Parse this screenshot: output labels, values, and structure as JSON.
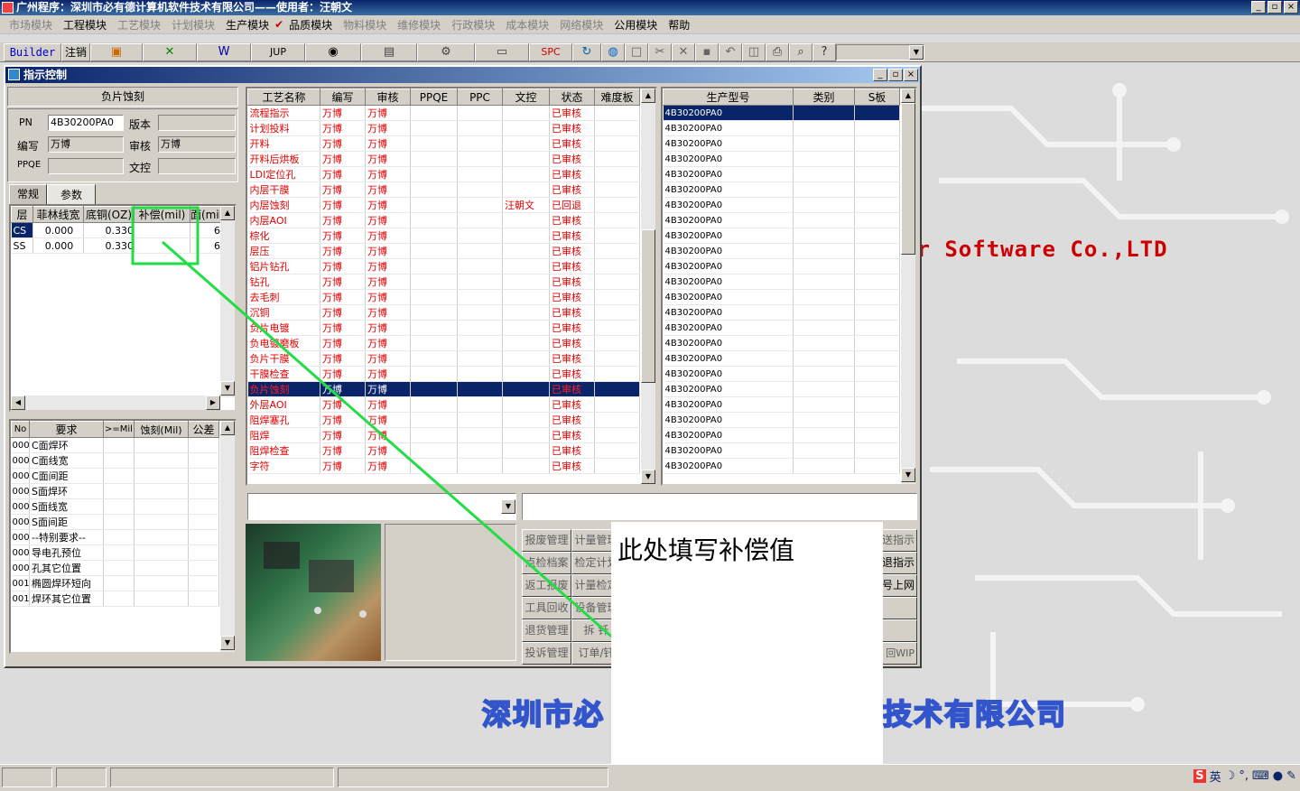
{
  "app": {
    "title": "广州程序：深圳市必有德计算机软件技术有限公司——使用者：汪朝文",
    "window_controls": [
      "_",
      "▫",
      "×"
    ]
  },
  "menu": [
    {
      "label": "市场模块",
      "enabled": false
    },
    {
      "label": "工程模块",
      "enabled": true
    },
    {
      "label": "工艺模块",
      "enabled": false
    },
    {
      "label": "计划模块",
      "enabled": false
    },
    {
      "label": "生产模块",
      "enabled": true
    },
    {
      "label": "品质模块",
      "enabled": true,
      "checked": true
    },
    {
      "label": "物料模块",
      "enabled": false
    },
    {
      "label": "维修模块",
      "enabled": false
    },
    {
      "label": "行政模块",
      "enabled": false
    },
    {
      "label": "成本模块",
      "enabled": false
    },
    {
      "label": "网络模块",
      "enabled": false
    },
    {
      "label": "公用模块",
      "enabled": true
    },
    {
      "label": "帮助",
      "enabled": true
    }
  ],
  "toolbar": {
    "builder": "Builder",
    "logout": "注销",
    "icons": [
      "ppt-icon",
      "excel-icon",
      "word-icon",
      "jup-icon",
      "eye-icon",
      "database-icon",
      "gears-icon",
      "monitor-icon",
      "spc-icon",
      "refresh-icon",
      "globe-icon",
      "new-icon",
      "cut-icon",
      "delete-icon",
      "save-icon",
      "undo-icon",
      "preview-icon",
      "print-icon",
      "find-icon",
      "help-icon"
    ],
    "jup": "JUP",
    "spc": "SPC",
    "combo_value": ""
  },
  "background": {
    "slogan": "er Software Co.,LTD",
    "company": "深圳市必",
    "company_tail": "技术有限公司"
  },
  "child": {
    "title": "指示控制",
    "process_name": "负片蚀刻",
    "fields": {
      "pn_label": "PN",
      "pn": "4B30200PA0",
      "version_label": "版本",
      "version": "",
      "author_label": "编写",
      "author": "万博",
      "reviewer_label": "审核",
      "reviewer": "万博",
      "ppqe_label": "PPQE",
      "ppqe": "",
      "doc_label": "文控",
      "doc": ""
    },
    "tabs": [
      "常规",
      "参数"
    ],
    "layer_table": {
      "headers": [
        "层",
        "菲林线宽",
        "底铜(OZ)",
        "补偿(mil)",
        "面(mil"
      ],
      "rows": [
        [
          "CS",
          "0.000",
          "0.330",
          "",
          "6"
        ],
        [
          "SS",
          "0.000",
          "0.330",
          "",
          "6"
        ]
      ]
    },
    "req_table": {
      "headers": [
        "No",
        "要求",
        ">=Mil",
        "蚀刻(Mil)",
        "公差"
      ],
      "rows": [
        [
          "000",
          "C面焊环"
        ],
        [
          "000",
          "C面线宽"
        ],
        [
          "000",
          "C面间距"
        ],
        [
          "000",
          "S面焊环"
        ],
        [
          "000",
          "S面线宽"
        ],
        [
          "000",
          "S面间距"
        ],
        [
          "000",
          "--特别要求--"
        ],
        [
          "000",
          "导电孔预位"
        ],
        [
          "000",
          "孔其它位置"
        ],
        [
          "001",
          "椭圆焊环短向"
        ],
        [
          "001",
          "焊环其它位置"
        ]
      ]
    },
    "process_table": {
      "headers": [
        "工艺名称",
        "编写",
        "审核",
        "PPQE",
        "PPC",
        "文控",
        "状态",
        "难度板"
      ],
      "selected_index": 18,
      "rows": [
        [
          "流程指示",
          "万博",
          "万博",
          "",
          "",
          "",
          "已审核"
        ],
        [
          "计划投料",
          "万博",
          "万博",
          "",
          "",
          "",
          "已审核"
        ],
        [
          "开料",
          "万博",
          "万博",
          "",
          "",
          "",
          "已审核"
        ],
        [
          "开料后烘板",
          "万博",
          "万博",
          "",
          "",
          "",
          "已审核"
        ],
        [
          "LDI定位孔",
          "万博",
          "万博",
          "",
          "",
          "",
          "已审核"
        ],
        [
          "内层干膜",
          "万博",
          "万博",
          "",
          "",
          "",
          "已审核"
        ],
        [
          "内层蚀刻",
          "万博",
          "万博",
          "",
          "",
          "汪朝文",
          "已回退"
        ],
        [
          "内层AOI",
          "万博",
          "万博",
          "",
          "",
          "",
          "已审核"
        ],
        [
          "棕化",
          "万博",
          "万博",
          "",
          "",
          "",
          "已审核"
        ],
        [
          "层压",
          "万博",
          "万博",
          "",
          "",
          "",
          "已审核"
        ],
        [
          "铝片钻孔",
          "万博",
          "万博",
          "",
          "",
          "",
          "已审核"
        ],
        [
          "钻孔",
          "万博",
          "万博",
          "",
          "",
          "",
          "已审核"
        ],
        [
          "去毛刺",
          "万博",
          "万博",
          "",
          "",
          "",
          "已审核"
        ],
        [
          "沉铜",
          "万博",
          "万博",
          "",
          "",
          "",
          "已审核"
        ],
        [
          "负片电镀",
          "万博",
          "万博",
          "",
          "",
          "",
          "已审核"
        ],
        [
          "负电镀磨板",
          "万博",
          "万博",
          "",
          "",
          "",
          "已审核"
        ],
        [
          "负片干膜",
          "万博",
          "万博",
          "",
          "",
          "",
          "已审核"
        ],
        [
          "干膜检查",
          "万博",
          "万博",
          "",
          "",
          "",
          "已审核"
        ],
        [
          "负片蚀刻",
          "万博",
          "万博",
          "",
          "",
          "",
          "已审核"
        ],
        [
          "外层AOI",
          "万博",
          "万博",
          "",
          "",
          "",
          "已审核"
        ],
        [
          "阻焊塞孔",
          "万博",
          "万博",
          "",
          "",
          "",
          "已审核"
        ],
        [
          "阻焊",
          "万博",
          "万博",
          "",
          "",
          "",
          "已审核"
        ],
        [
          "阻焊检查",
          "万博",
          "万博",
          "",
          "",
          "",
          "已审核"
        ],
        [
          "字符",
          "万博",
          "万博",
          "",
          "",
          "",
          "已审核"
        ]
      ]
    },
    "model_table": {
      "headers": [
        "生产型号",
        "类别",
        "S板"
      ],
      "model": "4B30200PA0",
      "row_count": 24
    },
    "combo_left": "",
    "text_right": "",
    "buttons_left": [
      [
        "报废管理",
        "计量管理"
      ],
      [
        "点检档案",
        "检定计划"
      ],
      [
        "返工报废",
        "计量检定"
      ],
      [
        "工具回收",
        "设备管理"
      ],
      [
        "退货管理",
        "拆 钎"
      ],
      [
        "投诉管理",
        "订单/钎"
      ]
    ],
    "buttons_right": [
      "送指示",
      "退指示",
      "号上网",
      "",
      "",
      "回WIP"
    ]
  },
  "callout": {
    "text": "此处填写补偿值"
  },
  "tray": {
    "ime": "英"
  }
}
